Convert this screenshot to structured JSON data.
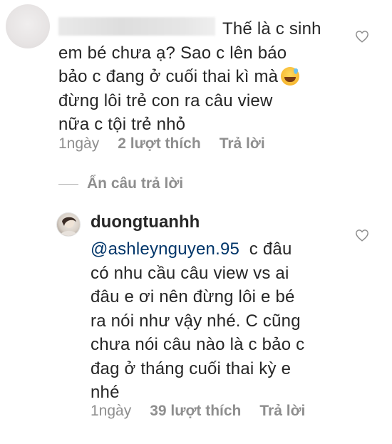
{
  "comment1": {
    "text_line1": "Thế là c sinh",
    "text_rest": "em bé chưa ạ? Sao c lên báo\nbảo c đang ở cuối thai kì mà",
    "text_tail": "đừng lôi trẻ con ra câu view\nnữa c tội trẻ nhỏ",
    "time": "1ngày",
    "likes": "2 lượt thích",
    "reply": "Trả lời"
  },
  "hide_replies": "Ẩn câu trả lời",
  "comment2": {
    "username": "duongtuanhh",
    "mention": "@ashleynguyen.95",
    "text_after_mention": "  c đâu",
    "text_rest": "có nhu cầu câu view vs ai\nđâu e ơi nên đừng lôi e bé\nra nói như vậy nhé. C cũng\nchưa nói câu nào là c bảo c\nđag ở tháng cuối thai kỳ e\nnhé",
    "time": "1ngày",
    "likes": "39 lượt thích",
    "reply": "Trả lời"
  },
  "icons": [
    "heart-icon",
    "sweat-smile-emoji"
  ]
}
